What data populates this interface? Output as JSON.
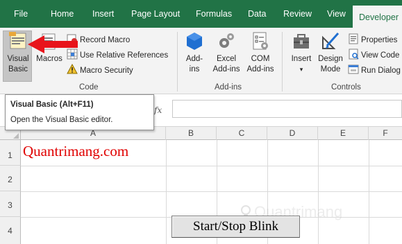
{
  "tabs": [
    {
      "id": "file",
      "label": "File"
    },
    {
      "id": "home",
      "label": "Home"
    },
    {
      "id": "insert",
      "label": "Insert"
    },
    {
      "id": "page_layout",
      "label": "Page Layout"
    },
    {
      "id": "formulas",
      "label": "Formulas"
    },
    {
      "id": "data",
      "label": "Data"
    },
    {
      "id": "review",
      "label": "Review"
    },
    {
      "id": "view",
      "label": "View"
    },
    {
      "id": "developer",
      "label": "Developer",
      "active": true
    }
  ],
  "ribbon": {
    "code": {
      "label": "Code",
      "visual_basic_line1": "Visual",
      "visual_basic_line2": "Basic",
      "macros": "Macros",
      "record_macro": "Record Macro",
      "use_relative_references": "Use Relative References",
      "macro_security": "Macro Security"
    },
    "addins": {
      "label": "Add-ins",
      "addins_line1": "Add-",
      "addins_line2": "ins",
      "excel_addins_line1": "Excel",
      "excel_addins_line2": "Add-ins",
      "com_addins_line1": "COM",
      "com_addins_line2": "Add-ins"
    },
    "controls": {
      "label": "Controls",
      "insert": "Insert",
      "design_mode_line1": "Design",
      "design_mode_line2": "Mode",
      "properties": "Properties",
      "view_code": "View Code",
      "run_dialog": "Run Dialog"
    }
  },
  "tooltip": {
    "title": "Visual Basic (Alt+F11)",
    "description": "Open the Visual Basic editor."
  },
  "formula_bar": {
    "fx": "fx",
    "value": ""
  },
  "grid": {
    "columns": [
      "A",
      "B",
      "C",
      "D",
      "E",
      "F"
    ],
    "rows": [
      "1",
      "2",
      "3",
      "4"
    ],
    "a1_value": "Quantrimang.com"
  },
  "form_button": {
    "label": "Start/Stop Blink"
  },
  "watermark": {
    "text": "Quantrimang"
  },
  "colors": {
    "ribbon_green": "#217346",
    "ribbon_bg": "#f3f3f3",
    "arrow_red": "#e8141b",
    "cell_text_red": "#e00000"
  }
}
